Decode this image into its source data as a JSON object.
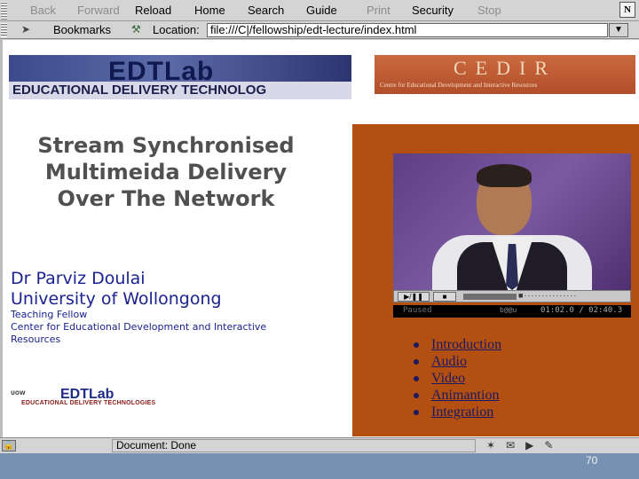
{
  "toolbar": {
    "buttons": [
      {
        "label": "Back",
        "enabled": false
      },
      {
        "label": "Forward",
        "enabled": false
      },
      {
        "label": "Reload",
        "enabled": true
      },
      {
        "label": "Home",
        "enabled": true
      },
      {
        "label": "Search",
        "enabled": true
      },
      {
        "label": "Guide",
        "enabled": true
      },
      {
        "label": "Print",
        "enabled": false
      },
      {
        "label": "Security",
        "enabled": true
      },
      {
        "label": "Stop",
        "enabled": false
      }
    ],
    "logo": "N"
  },
  "location_bar": {
    "bookmarks_label": "Bookmarks",
    "location_label": "Location:",
    "url": "file:///C|/fellowship/edt-lecture/index.html"
  },
  "page": {
    "edt_logo_big": "EDTLab",
    "edt_logo_sub": "EDUCATIONAL DELIVERY TECHNOLOG",
    "cedir_title": "CEDIR",
    "cedir_sub": "Centre for Educational Development and Interactive Resources",
    "title_lines": [
      "Stream Synchronised",
      "Multimeida Delivery",
      "Over The Network"
    ],
    "author_name": "Dr Parviz Doulai",
    "author_affil": "University of Wollongong",
    "fellow_lines": [
      "Teaching Fellow",
      "Center for Educational Development and Interactive",
      "Resources"
    ],
    "uow_letters": "UOW",
    "edt_small": "EDTLab",
    "edt_small_sub": "EDUCATIONAL DELIVERY TECHNOLOGIES",
    "player": {
      "status": "Paused",
      "logo": "b@@u",
      "time": "01:02.0 / 02:40.3"
    },
    "menu": [
      "Introduction",
      "Audio",
      "Video",
      "Animantion",
      "Integration"
    ]
  },
  "statusbar": {
    "text": "Document: Done"
  },
  "slide_number": "70",
  "colors": {
    "orange_panel": "#b34f10",
    "link": "#1b1a60",
    "author": "#1a238f",
    "bottom_band": "#7691b1"
  }
}
